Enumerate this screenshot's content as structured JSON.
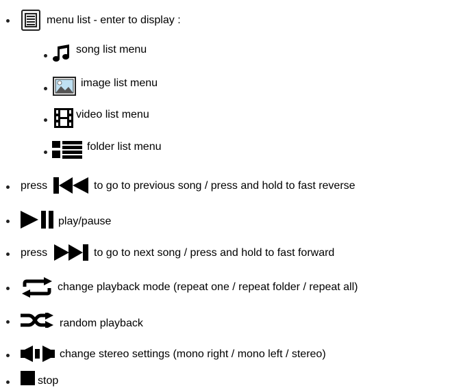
{
  "items": [
    {
      "icon": "menu-list-icon",
      "text": "menu list - enter to display :"
    },
    {
      "icon": "song-note-icon",
      "text": "song list menu"
    },
    {
      "icon": "image-icon",
      "text": "image list menu"
    },
    {
      "icon": "film-icon",
      "text": "video list menu"
    },
    {
      "icon": "folder-list-icon",
      "text": "folder list menu"
    },
    {
      "icon": "previous-track-icon",
      "prefix": "press",
      "text": "to go to previous song / press and hold to fast reverse"
    },
    {
      "icon": "play-pause-icon",
      "text": "play/pause"
    },
    {
      "icon": "next-track-icon",
      "prefix": "press",
      "text": "to go to next song / press and hold to fast forward"
    },
    {
      "icon": "repeat-icon",
      "text": "change playback mode (repeat one / repeat folder / repeat all)"
    },
    {
      "icon": "shuffle-icon",
      "text": "random playback"
    },
    {
      "icon": "stereo-icon",
      "text": "change stereo settings (mono right / mono left / stereo)"
    },
    {
      "icon": "stop-icon",
      "text": "stop"
    }
  ]
}
